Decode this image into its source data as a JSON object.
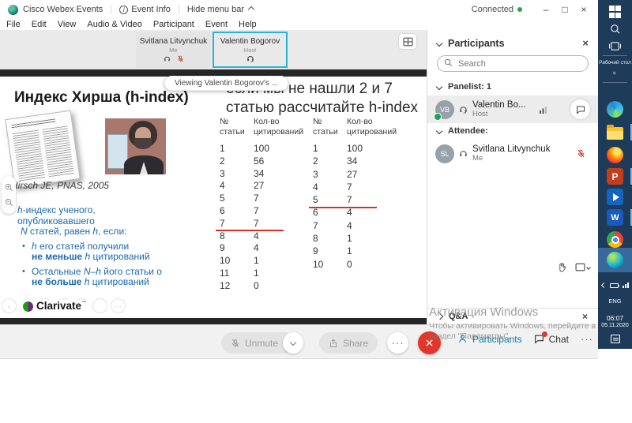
{
  "colors": {
    "accent_cyan": "#2ab3d9",
    "underline_red": "#d93025",
    "slide_blue": "#1a68ae",
    "taskbar_blue": "#1e3c5a",
    "leave_red": "#e2362a",
    "participants_teal": "#0a7aa5",
    "connected_green": "#31a24c"
  },
  "titlebar": {
    "app": "Cisco Webex Events",
    "event_info": "Event Info",
    "hide_menu": "Hide menu bar",
    "connected": "Connected",
    "minimize": "–",
    "maximize": "□",
    "close": "×"
  },
  "menu": {
    "items": [
      "File",
      "Edit",
      "View",
      "Audio & Video",
      "Participant",
      "Event",
      "Help"
    ]
  },
  "participants_data": {
    "svitlana": {
      "name": "Svitlana Litvynchuk",
      "role": "Me",
      "initials": "SL"
    },
    "valentin": {
      "name": "Valentin Bogorov",
      "name_short": "Valentin Bo...",
      "role": "Host",
      "initials": "VB"
    }
  },
  "tooltip": "Viewing Valentin Bogorov's ...",
  "slide": {
    "left_title": "Индекс Хирша (h-index)",
    "citation": "Hirsch JE, PNAS, 2005",
    "right_title_line1": "если мы не нашли 2 и 7",
    "right_title_line2": "статью рассчитайте h-index",
    "bullets": {
      "l1": [
        {
          "i": "h"
        },
        {
          "t": "-индекс ученого,"
        }
      ],
      "l2": [
        {
          "t": "опубликовавшего"
        }
      ],
      "l3": [
        {
          "i": "N"
        },
        {
          "t": " статей, равен "
        },
        {
          "i": "h"
        },
        {
          "t": ", если:"
        }
      ],
      "s1l1": [
        {
          "i": "h"
        },
        {
          "t": " его статей получили"
        }
      ],
      "s1l2": [
        {
          "b": "не меньше"
        },
        {
          "t": " "
        },
        {
          "i": "h"
        },
        {
          "t": " цитирований"
        }
      ],
      "s2l1": [
        {
          "t": "Остальные "
        },
        {
          "i": "N–h"
        },
        {
          "t": " його статьи о"
        }
      ],
      "s2l2": [
        {
          "b": "не больше"
        },
        {
          "t": " "
        },
        {
          "i": "h"
        },
        {
          "t": " цитирований"
        }
      ]
    },
    "logo_text": "Clarivate",
    "tables": [
      {
        "col1": "№\nстатьи",
        "col2": "Кол-во\nцитирований",
        "rows": [
          [
            1,
            100
          ],
          [
            2,
            56
          ],
          [
            3,
            34
          ],
          [
            4,
            27
          ],
          [
            5,
            7
          ],
          [
            6,
            7
          ],
          [
            7,
            7
          ],
          [
            8,
            4
          ],
          [
            9,
            4
          ],
          [
            10,
            1
          ],
          [
            11,
            1
          ],
          [
            12,
            0
          ]
        ],
        "underline_after": 7
      },
      {
        "col1": "№\nстатьи",
        "col2": "Кол-во\nцитирований",
        "rows": [
          [
            1,
            100
          ],
          [
            2,
            34
          ],
          [
            3,
            27
          ],
          [
            4,
            7
          ],
          [
            5,
            7
          ],
          [
            6,
            4
          ],
          [
            7,
            4
          ],
          [
            8,
            1
          ],
          [
            9,
            1
          ],
          [
            10,
            0
          ]
        ],
        "underline_after": 5
      }
    ]
  },
  "panel": {
    "title": "Participants",
    "search_placeholder": "Search",
    "panelist_label": "Panelist: 1",
    "attendee_label": "Attendee:",
    "qa_label": "Q&A",
    "close": "×"
  },
  "footer": {
    "unmute": "Unmute",
    "share": "Share",
    "participants": "Participants",
    "chat": "Chat",
    "more": "···"
  },
  "watermark": {
    "line1": "Активация Windows",
    "line2": "Чтобы активировать Windows, перейдите в",
    "line3": "раздел \"Параметры\"."
  },
  "taskbar": {
    "desktop_label": "Рабочий стол",
    "desktop_chevron": "»",
    "lang": "ENG",
    "time": "06:07",
    "date": "05.11.2020"
  }
}
